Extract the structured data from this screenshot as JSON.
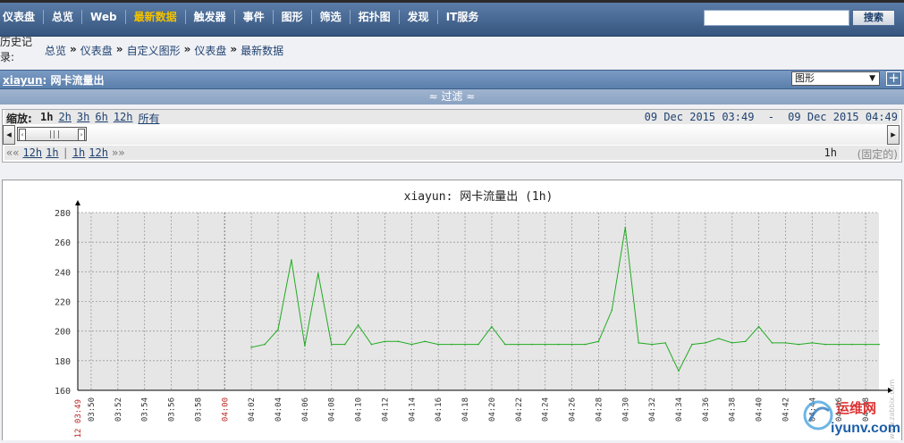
{
  "nav": {
    "items": [
      {
        "label": "仪表盘",
        "active": false
      },
      {
        "label": "总览",
        "active": false
      },
      {
        "label": "Web",
        "active": false
      },
      {
        "label": "最新数据",
        "active": true
      },
      {
        "label": "触发器",
        "active": false
      },
      {
        "label": "事件",
        "active": false
      },
      {
        "label": "图形",
        "active": false
      },
      {
        "label": "筛选",
        "active": false
      },
      {
        "label": "拓扑图",
        "active": false
      },
      {
        "label": "发现",
        "active": false
      },
      {
        "label": "IT服务",
        "active": false
      }
    ],
    "search_value": "",
    "search_button": "搜索"
  },
  "history": {
    "label": "历史记录:",
    "crumbs": [
      "总览",
      "仪表盘",
      "自定义图形",
      "仪表盘",
      "最新数据"
    ],
    "separator": "»"
  },
  "titlebar": {
    "host": "xiayun",
    "rest": ": 网卡流量出",
    "select_value": "图形",
    "add_label": "+"
  },
  "filter": {
    "label": "≈ 过滤 ≈"
  },
  "zoom": {
    "label": "缩放:",
    "links": [
      "1h",
      "2h",
      "3h",
      "6h",
      "12h",
      "所有"
    ],
    "from": "09 Dec 2015 03:49",
    "dash": "-",
    "to": "09 Dec 2015 04:49",
    "nav": [
      "««",
      "12h",
      "1h",
      "|",
      "1h",
      "12h",
      "»»"
    ],
    "period": "1h",
    "fixed": "(固定的)"
  },
  "chart_data": {
    "type": "line",
    "title": "xiayun: 网卡流量出 (1h)",
    "ylim": [
      160,
      280
    ],
    "yticks": [
      160,
      180,
      200,
      220,
      240,
      260,
      280
    ],
    "xlim": [
      "03:49",
      "04:49"
    ],
    "xticks": [
      "03:50",
      "03:52",
      "03:54",
      "03:56",
      "03:58",
      "04:00",
      "04:02",
      "04:04",
      "04:06",
      "04:08",
      "04:10",
      "04:12",
      "04:14",
      "04:16",
      "04:18",
      "04:20",
      "04:22",
      "04:24",
      "04:26",
      "04:28",
      "04:30",
      "04:32",
      "04:34",
      "04:36",
      "04:38",
      "04:40",
      "04:42",
      "04:44",
      "04:46",
      "04:48"
    ],
    "x_start_label": "12 03:49",
    "grid": true,
    "series": [
      {
        "color": "#22aa22",
        "points": [
          [
            "04:02",
            189
          ],
          [
            "04:03",
            191
          ],
          [
            "04:04",
            201
          ],
          [
            "04:05",
            248
          ],
          [
            "04:06",
            190
          ],
          [
            "04:07",
            239
          ],
          [
            "04:08",
            191
          ],
          [
            "04:09",
            191
          ],
          [
            "04:10",
            204
          ],
          [
            "04:11",
            191
          ],
          [
            "04:12",
            193
          ],
          [
            "04:13",
            193
          ],
          [
            "04:14",
            191
          ],
          [
            "04:15",
            193
          ],
          [
            "04:16",
            191
          ],
          [
            "04:17",
            191
          ],
          [
            "04:18",
            191
          ],
          [
            "04:19",
            191
          ],
          [
            "04:20",
            203
          ],
          [
            "04:21",
            191
          ],
          [
            "04:22",
            191
          ],
          [
            "04:23",
            191
          ],
          [
            "04:24",
            191
          ],
          [
            "04:25",
            191
          ],
          [
            "04:26",
            191
          ],
          [
            "04:27",
            191
          ],
          [
            "04:28",
            193
          ],
          [
            "04:29",
            214
          ],
          [
            "04:30",
            270
          ],
          [
            "04:31",
            192
          ],
          [
            "04:32",
            191
          ],
          [
            "04:33",
            192
          ],
          [
            "04:34",
            173
          ],
          [
            "04:35",
            191
          ],
          [
            "04:36",
            192
          ],
          [
            "04:37",
            195
          ],
          [
            "04:38",
            192
          ],
          [
            "04:39",
            193
          ],
          [
            "04:40",
            203
          ],
          [
            "04:41",
            192
          ],
          [
            "04:42",
            192
          ],
          [
            "04:43",
            191
          ],
          [
            "04:44",
            192
          ],
          [
            "04:45",
            191
          ],
          [
            "04:46",
            191
          ],
          [
            "04:47",
            191
          ],
          [
            "04:48",
            191
          ],
          [
            "04:49",
            191
          ]
        ]
      }
    ],
    "watermark": "www.zabbix.com"
  },
  "site_watermark": {
    "cn": "运维网",
    "url": "iyunv.com"
  }
}
